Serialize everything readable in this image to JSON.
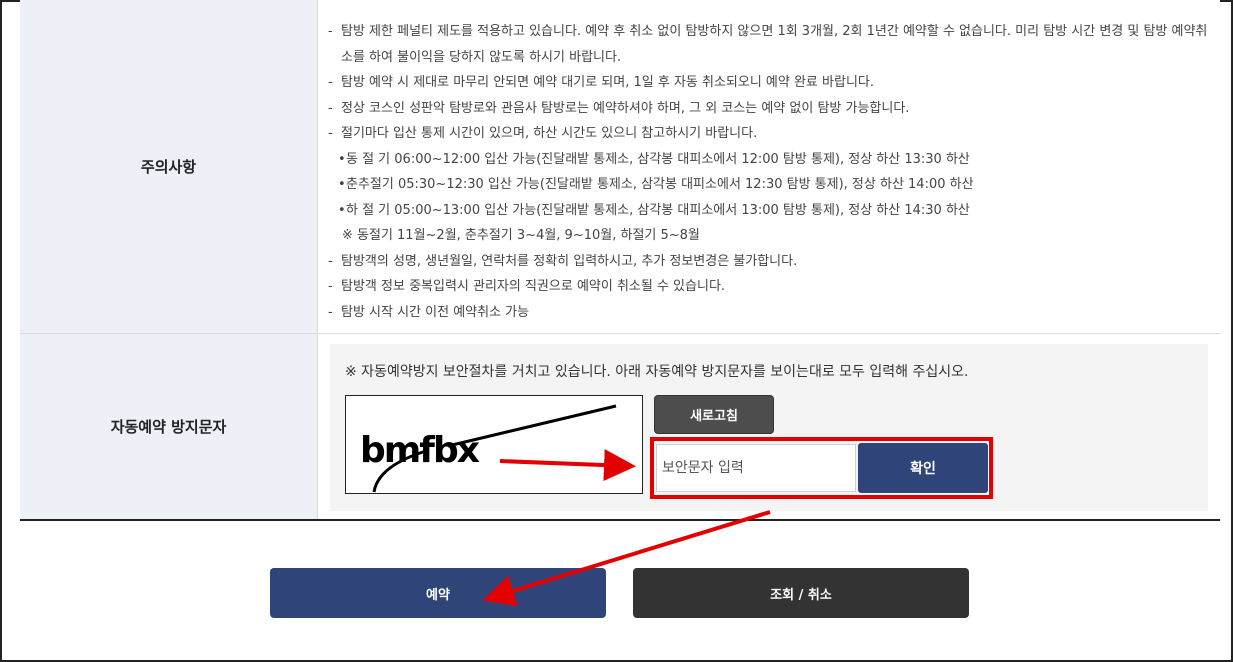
{
  "notice": {
    "label": "주의사항",
    "items": [
      {
        "type": "dash",
        "text": "탐방 제한 페널티 제도를 적용하고 있습니다. 예약 후 취소 없이 탐방하지 않으면 1회 3개월, 2회 1년간 예약할 수 없습니다. 미리 탐방 시간 변경 및 탐방 예약취소를 하여 불이익을 당하지 않도록 하시기 바랍니다."
      },
      {
        "type": "dash",
        "text": "탐방 예약 시 제대로 마무리 안되면 예약 대기로 되며, 1일 후 자동 취소되오니 예약 완료 바랍니다."
      },
      {
        "type": "dash",
        "text": "정상 코스인 성판악 탐방로와 관음사 탐방로는 예약하셔야 하며, 그 외 코스는 예약 없이 탐방 가능합니다."
      },
      {
        "type": "dash",
        "text": "절기마다 입산 통제 시간이 있으며, 하산 시간도 있으니 참고하시기 바랍니다."
      },
      {
        "type": "sub",
        "text": "동 절 기 06:00~12:00 입산 가능(진달래밭 통제소, 삼각봉 대피소에서 12:00 탐방 통제), 정상 하산 13:30 하산"
      },
      {
        "type": "sub",
        "text": "춘추절기 05:30~12:30 입산 가능(진달래밭 통제소, 삼각봉 대피소에서 12:30 탐방 통제), 정상 하산 14:00 하산"
      },
      {
        "type": "sub",
        "text": "하 절 기 05:00~13:00 입산 가능(진달래밭 통제소, 삼각봉 대피소에서 13:00 탐방 통제), 정상 하산 14:30 하산"
      },
      {
        "type": "note",
        "text": "※ 동절기 11월~2월, 춘추절기 3~4월, 9~10월, 하절기 5~8월"
      },
      {
        "type": "dash",
        "text": "탐방객의 성명, 생년월일, 연락처를 정확히 입력하시고, 추가 정보변경은 불가합니다."
      },
      {
        "type": "dash",
        "text": "탐방객 정보 중복입력시 관리자의 직권으로 예약이 취소될 수 있습니다."
      },
      {
        "type": "dash",
        "text": "탐방 시작 시간 이전 예약취소 가능"
      }
    ]
  },
  "captcha": {
    "label": "자동예약 방지문자",
    "message": "※ 자동예약방지 보안절차를 거치고 있습니다. 아래 자동예약 방지문자를 보이는대로 모두 입력해 주십시오.",
    "image_text": "bmfbx",
    "refresh_label": "새로고침",
    "input_placeholder": "보안문자 입력",
    "input_value": "",
    "confirm_label": "확인"
  },
  "actions": {
    "reserve_label": "예약",
    "lookup_label": "조회 / 취소"
  },
  "colors": {
    "primary": "#2f4478",
    "dark": "#333333",
    "header_bg": "#eef0f8",
    "annotation_red": "#e30000"
  }
}
